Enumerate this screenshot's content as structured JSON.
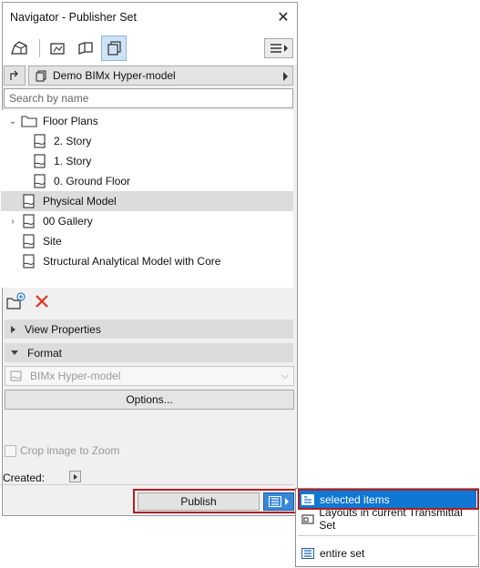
{
  "window": {
    "title": "Navigator - Publisher Set"
  },
  "toolbar": {
    "icons": [
      "project-map-icon",
      "view-map-icon",
      "layout-book-icon",
      "publisher-sets-icon"
    ],
    "active": "publisher-sets-icon"
  },
  "set": {
    "name": "Demo BIMx Hyper-model"
  },
  "search": {
    "placeholder": "Search by name"
  },
  "tree": [
    {
      "label": "Floor Plans",
      "type": "folder",
      "level": 0,
      "expanded": true
    },
    {
      "label": "2. Story",
      "type": "view",
      "level": 1
    },
    {
      "label": "1. Story",
      "type": "view",
      "level": 1
    },
    {
      "label": "0. Ground Floor",
      "type": "view",
      "level": 1
    },
    {
      "label": "Physical Model",
      "type": "view",
      "level": 0,
      "selected": true
    },
    {
      "label": "00 Gallery",
      "type": "view",
      "level": 0,
      "collapsed": true
    },
    {
      "label": "Site",
      "type": "view",
      "level": 0
    },
    {
      "label": "Structural Analytical Model with Core",
      "type": "view",
      "level": 0
    }
  ],
  "panels": {
    "view_properties": "View Properties",
    "format": "Format"
  },
  "format": {
    "selected": "BIMx Hyper-model",
    "options_label": "Options..."
  },
  "crop": {
    "label": "Crop image to Zoom",
    "checked": false
  },
  "created": {
    "label": "Created:"
  },
  "publish": {
    "label": "Publish"
  },
  "popup": {
    "items": [
      {
        "label": "selected items",
        "selected": true
      },
      {
        "label": "Layouts in current Transmittal Set",
        "selected": false
      },
      {
        "label": "entire set",
        "selected": false
      }
    ]
  },
  "colors": {
    "highlight": "#1177d4",
    "callout_border": "#b01e23",
    "selected_row": "#dcdcdc",
    "delete": "#e0301e"
  }
}
